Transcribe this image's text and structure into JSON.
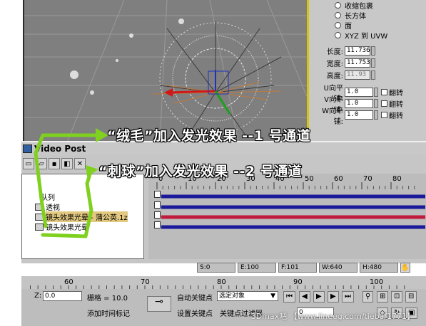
{
  "viewport": {
    "name": ""
  },
  "param_panel": {
    "mapping_options": [
      "收缩包裹",
      "长方体",
      "面",
      "XYZ 到 UVW"
    ],
    "length_label": "长度:",
    "length_value": "11.736",
    "width_label": "宽度:",
    "width_value": "11.753",
    "height_label": "高度:",
    "height_value": "11.93",
    "u_tile_label": "U向平铺:",
    "u_tile_value": "1.0",
    "u_flip": "翻转",
    "v_tile_label": "V向平铺:",
    "v_tile_value": "1.0",
    "v_flip": "翻转",
    "w_tile_label": "W向平铺:",
    "w_tile_value": "1.0",
    "w_flip": "翻转"
  },
  "video_post": {
    "title": "Video Post",
    "queue_label": "队列",
    "perspective_label": "透视",
    "event_1": "镜头效果光晕 - 蒲公英.1z",
    "event_2": "镜头效果光晕",
    "ruler_ticks": [
      "0",
      "10",
      "20",
      "30",
      "40",
      "50",
      "60",
      "70",
      "80"
    ],
    "status": {
      "s": "S:0",
      "e": "E:100",
      "f": "F:101",
      "w": "W:640",
      "h": "H:480"
    }
  },
  "annotations": {
    "line1": "“绒毛”加入发光效果 --1 号通道",
    "line2": "“刺球”加入发光效果 --2 号通道",
    "accent": "#7fd01f"
  },
  "timeline": {
    "ticks": [
      "60",
      "70",
      "80",
      "90",
      "100"
    ]
  },
  "bottom": {
    "z_label": "Z:",
    "z_value": "0.0",
    "grid_label": "栅格 = 10.0",
    "add_time_tag": "添加时间标记",
    "auto_key": "自动关键点",
    "selected_object": "选定对象",
    "set_key": "设置关键点",
    "key_filter": "关键点过滤器...",
    "frame_value": "0"
  },
  "watermark": "3Dmax吧 【www.lineeg.com/tieba/1771】"
}
